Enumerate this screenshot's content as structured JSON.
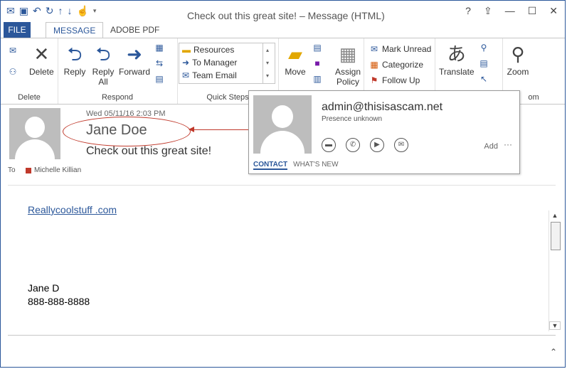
{
  "window": {
    "title": "Check out this great site! – Message (HTML)",
    "controls": [
      "?",
      "⇪",
      "—",
      "☐",
      "✕"
    ]
  },
  "quick_access": [
    "mail-icon",
    "save-icon",
    "undo-icon",
    "redo-icon",
    "up-icon",
    "down-icon",
    "touch-icon"
  ],
  "tabs": [
    {
      "label": "FILE"
    },
    {
      "label": "MESSAGE"
    },
    {
      "label": "ADOBE PDF"
    }
  ],
  "ribbon": {
    "delete": {
      "group": "Delete",
      "delete_label": "Delete"
    },
    "respond": {
      "group": "Respond",
      "reply": "Reply",
      "reply_all_1": "Reply",
      "reply_all_2": "All",
      "forward": "Forward"
    },
    "quick_steps": {
      "group": "Quick Steps",
      "items": [
        "Resources",
        "To Manager",
        "Team Email"
      ]
    },
    "move": {
      "move": "Move",
      "assign": "Assign",
      "policy": "Policy"
    },
    "tags": {
      "mark_unread": "Mark Unread",
      "categorize": "Categorize",
      "follow_up": "Follow Up"
    },
    "editing": {
      "translate": "Translate"
    },
    "zoom": {
      "zoom": "Zoom",
      "group_tail": "om"
    }
  },
  "message": {
    "date": "Wed 05/11/16 2:03 PM",
    "sender": "Jane Doe",
    "subject": "Check out this great site!",
    "to_label": "To",
    "recipient": "Michelle Killian",
    "link": "Reallycoolstuff .com",
    "signature_name": "Jane D",
    "signature_phone": "888-888-8888"
  },
  "contact_card": {
    "email": "admin@thisisascam.net",
    "presence": "Presence unknown",
    "add": "Add",
    "more": "···",
    "tab_contact": "CONTACT",
    "tab_whats_new": "WHAT'S NEW"
  },
  "colors": {
    "accent": "#2b579a",
    "annotation": "#c0392b"
  }
}
